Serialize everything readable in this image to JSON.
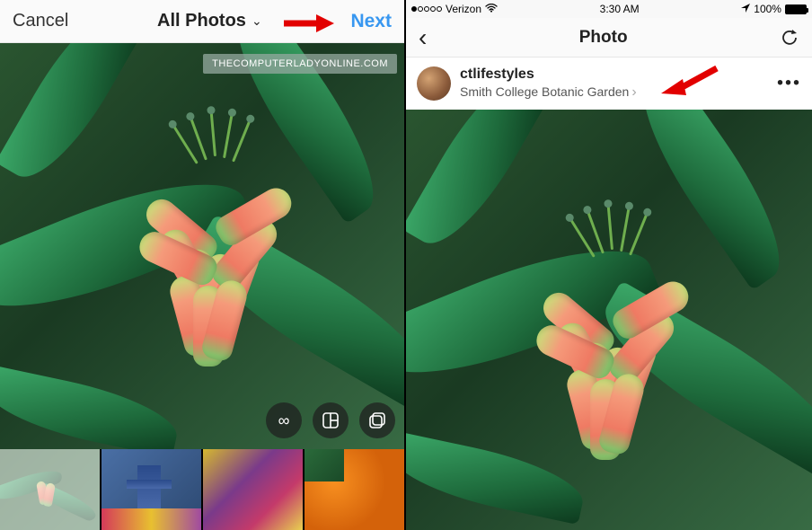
{
  "left": {
    "cancel": "Cancel",
    "title": "All Photos",
    "next": "Next",
    "watermark": "THECOMPUTERLADYONLINE.COM",
    "tools": {
      "boomerang": "boomerang-icon",
      "collage": "collage-icon",
      "multi": "multi-select-icon"
    }
  },
  "right": {
    "status": {
      "carrier": "Verizon",
      "time": "3:30 AM",
      "battery": "100%"
    },
    "nav": {
      "title": "Photo"
    },
    "post": {
      "username": "ctlifestyles",
      "location": "Smith College Botanic Garden"
    }
  }
}
